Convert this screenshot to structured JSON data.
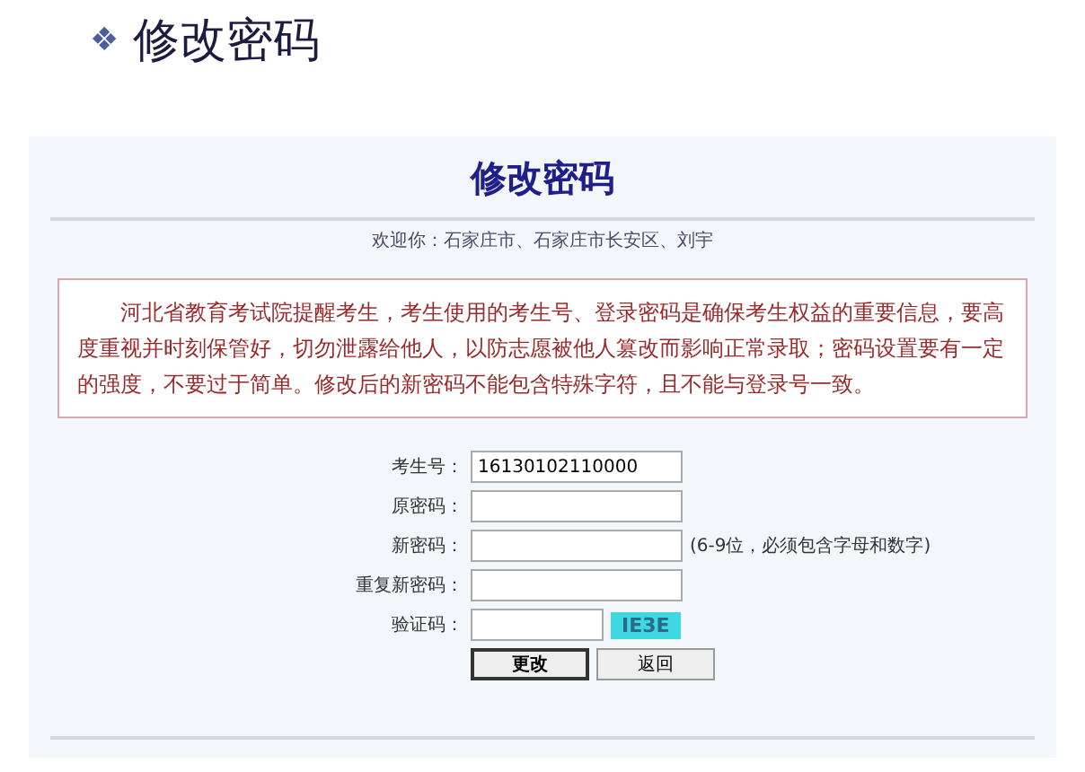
{
  "slide": {
    "bullet": "❖",
    "title": "修改密码"
  },
  "page": {
    "heading": "修改密码",
    "welcome": "欢迎你：石家庄市、石家庄市长安区、刘宇",
    "notice": "河北省教育考试院提醒考生，考生使用的考生号、登录密码是确保考生权益的重要信息，要高度重视并时刻保管好，切勿泄露给他人，以防志愿被他人篡改而影响正常录取；密码设置要有一定的强度，不要过于简单。修改后的新密码不能包含特殊字符，且不能与登录号一致。",
    "fields": [
      {
        "kind": "text",
        "label": "考生号：",
        "value": "16130102110000"
      },
      {
        "kind": "text",
        "label": "原密码："
      },
      {
        "kind": "text",
        "label": "新密码：",
        "hint": "(6-9位，必须包含字母和数字)"
      },
      {
        "kind": "text",
        "label": "重复新密码："
      },
      {
        "kind": "captcha",
        "label": "验证码：",
        "code": "IE3E"
      }
    ],
    "buttons": [
      {
        "label": "更改",
        "focused": true
      },
      {
        "label": "返回",
        "focused": false
      }
    ]
  }
}
